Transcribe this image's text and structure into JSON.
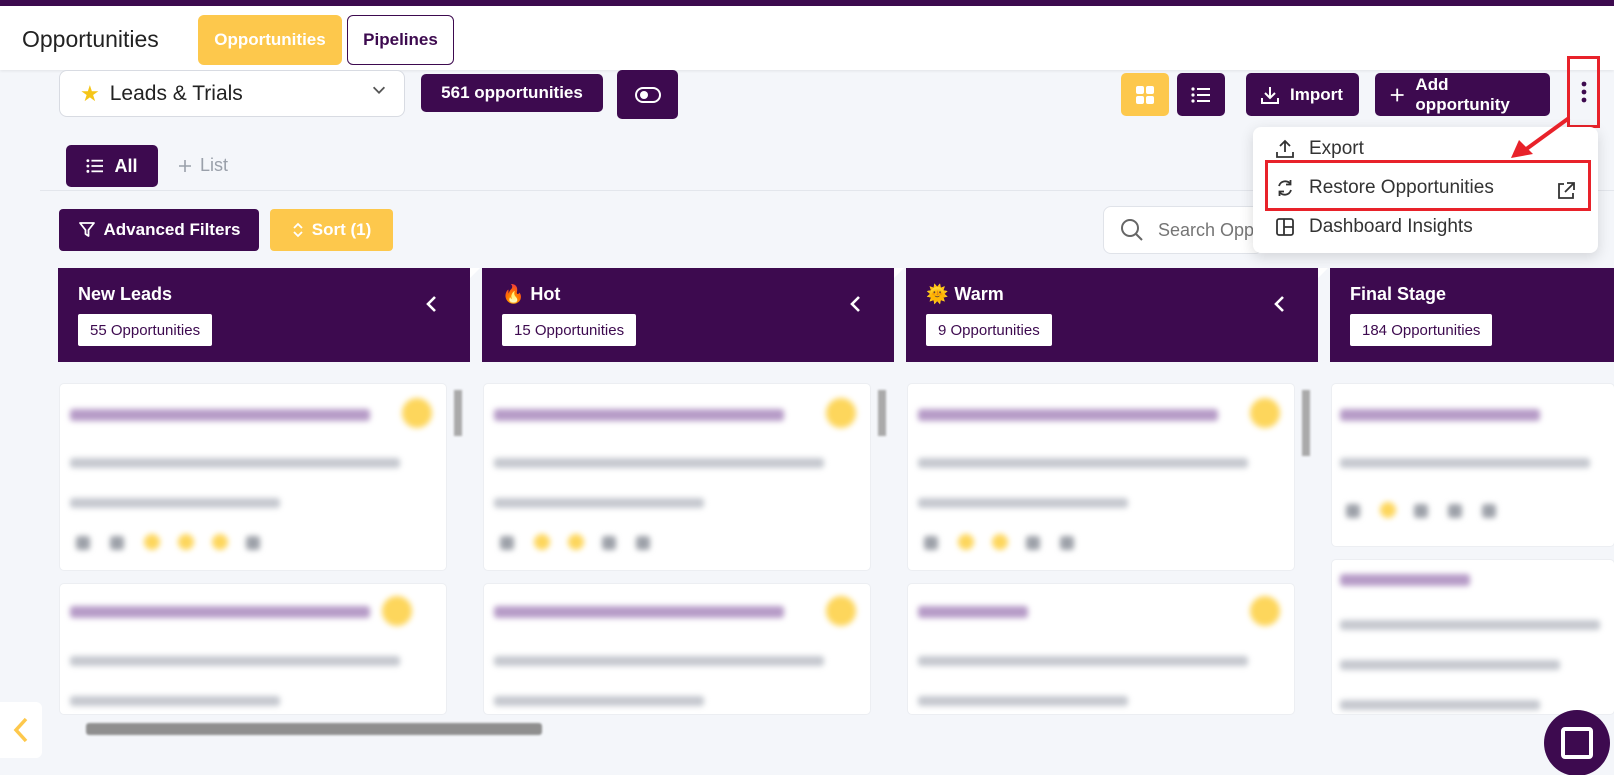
{
  "header": {
    "title": "Opportunities",
    "tabs": [
      {
        "label": "Opportunities",
        "active": true
      },
      {
        "label": "Pipelines",
        "active": false
      }
    ]
  },
  "toolbar": {
    "pipeline_selected": "Leads & Trials",
    "opportunity_count": "561 opportunities",
    "import_label": "Import",
    "add_label": "Add opportunity"
  },
  "lists": {
    "all_label": "All",
    "add_list_label": "List"
  },
  "filters": {
    "advanced_label": "Advanced Filters",
    "sort_label": "Sort (1)",
    "search_placeholder": "Search Opportunities"
  },
  "menu": {
    "items": [
      {
        "label": "Export",
        "icon": "upload-icon"
      },
      {
        "label": "Restore Opportunities",
        "icon": "refresh-icon",
        "highlighted": true
      },
      {
        "label": "Dashboard Insights",
        "icon": "dashboard-icon"
      }
    ]
  },
  "stages": [
    {
      "name": "New Leads",
      "emoji": "",
      "count": "55 Opportunities"
    },
    {
      "name": "Hot",
      "emoji": "🔥",
      "count": "15 Opportunities"
    },
    {
      "name": "Warm",
      "emoji": "🌞",
      "count": "9 Opportunities"
    },
    {
      "name": "Final Stage",
      "emoji": "",
      "count": "184 Opportunities"
    }
  ],
  "colors": {
    "primary": "#3d0a4f",
    "accent": "#fdc84c",
    "highlight": "#e8222a"
  }
}
